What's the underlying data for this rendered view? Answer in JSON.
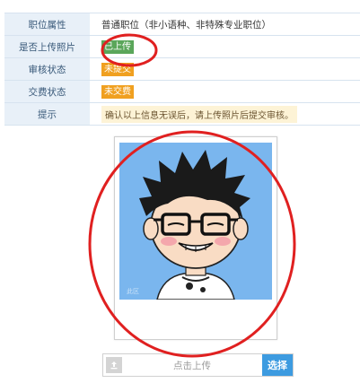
{
  "rows": [
    {
      "label": "职位属性",
      "value": "普通职位（非小语种、非特殊专业职位）"
    },
    {
      "label": "是否上传照片",
      "value": "已上传"
    },
    {
      "label": "审核状态",
      "value": "未提交"
    },
    {
      "label": "交费状态",
      "value": "未交费"
    },
    {
      "label": "提示",
      "value": "确认以上信息无误后，请上传照片后提交审核。"
    }
  ],
  "colors": {
    "label_bg": "#e8f0f8",
    "label_text": "#3a5a7a",
    "badge_green": "#5aa65a",
    "badge_orange": "#f0a020",
    "notice_bg": "#fdf3d6",
    "annotation_red": "#e02020",
    "choose_button": "#3d9be0"
  },
  "photo": {
    "icon": "avatar-cartoon-photo",
    "watermark": "此区"
  },
  "upload": {
    "text": "点击上传",
    "button": "选择",
    "icon": "upload-icon"
  }
}
